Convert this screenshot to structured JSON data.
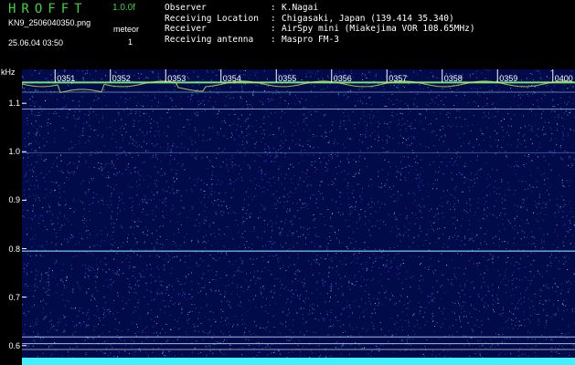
{
  "header": {
    "logo": "HROFFT",
    "version": "1.0.0f",
    "filename": "KN9_2506040350.png",
    "datetime": "25.06.04 03:50",
    "meteor_label": "meteor",
    "meteor_count": "1",
    "info": [
      {
        "key": "Observer",
        "value": "K.Nagai"
      },
      {
        "key": "Receiving Location",
        "value": "Chigasaki, Japan (139.414 35.340)"
      },
      {
        "key": "Receiver",
        "value": "AirSpy mini (Miakejima VOR 108.65MHz)"
      },
      {
        "key": "Receiving antenna",
        "value": "Maspro FM-3"
      }
    ]
  },
  "axis": {
    "unit": "kHz",
    "y_ticks": [
      "1.1",
      "1.0",
      "0.9",
      "0.8",
      "0.7",
      "0.6"
    ],
    "y_values": [
      1.1,
      1.0,
      0.9,
      0.8,
      0.7,
      0.6
    ],
    "ylim": [
      0.56,
      1.17
    ],
    "time_ticks": [
      "0351",
      "0352",
      "0353",
      "0354",
      "0355",
      "0356",
      "0357",
      "0358",
      "0359",
      "0400"
    ]
  },
  "colors": {
    "background": "#020a4a",
    "noise": "#4aa8ff",
    "carrier": "#7fff7f",
    "logo": "#3cd23c"
  }
}
